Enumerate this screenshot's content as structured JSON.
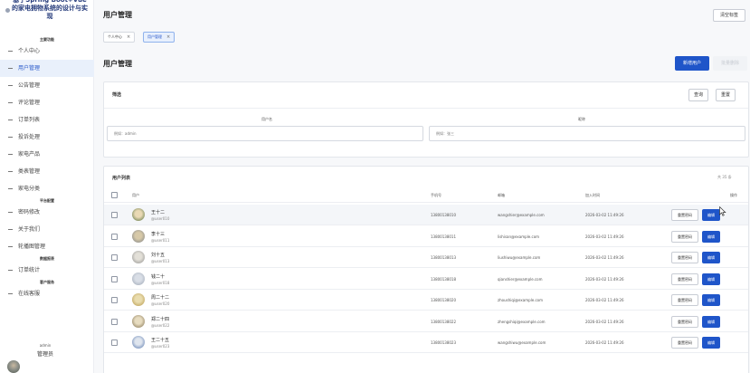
{
  "sidebar": {
    "brand_title": "基于Spring Boot+Vue的家电拥物系统的设计与实现",
    "items": [
      {
        "group": "主要功能"
      },
      {
        "label": "个人中心"
      },
      {
        "label": "用户管理",
        "active": true
      },
      {
        "label": "公告管理"
      },
      {
        "label": "评论管理"
      },
      {
        "label": "订单列表"
      },
      {
        "label": "投诉处理"
      },
      {
        "label": "家电产品"
      },
      {
        "label": "类表管理"
      },
      {
        "label": "家电分类"
      },
      {
        "group": "平台配置"
      },
      {
        "label": "密码修改"
      },
      {
        "label": "关于我们"
      },
      {
        "label": "轮播图管理"
      },
      {
        "group": "数据报表"
      },
      {
        "label": "订单统计"
      },
      {
        "group": "客户服务"
      },
      {
        "label": "在线客服"
      }
    ],
    "user": {
      "name": "admin",
      "role": "管理员"
    }
  },
  "header": {
    "title": "用户管理",
    "clear_tabs": "清空标签"
  },
  "tabs": [
    {
      "label": "个人中心",
      "close": "×"
    },
    {
      "label": "用户管理",
      "close": "×",
      "active": true
    }
  ],
  "section": {
    "title": "用户管理",
    "add_button": "新增用户",
    "faded_button": "批量删除"
  },
  "filter": {
    "title": "筛选",
    "query_button": "查询",
    "reset_button": "重置",
    "username_label": "用户名",
    "username_placeholder": "例如：admin",
    "nickname_label": "昵称",
    "nickname_placeholder": "例如：张三"
  },
  "table": {
    "title": "用户列表",
    "total": "共 35 条",
    "columns": {
      "user": "用户",
      "phone": "手机号",
      "email": "邮箱",
      "created": "加入时间",
      "actions": "操作"
    },
    "reset_pwd_label": "重置密码",
    "edit_label": "编辑",
    "rows": [
      {
        "name": "王十二",
        "username": "@user010",
        "phone": "13800138010",
        "email": "wangshier@example.com",
        "created": "2026-03-02 11:49:26"
      },
      {
        "name": "李十三",
        "username": "@user011",
        "phone": "13800138011",
        "email": "lishisan@example.com",
        "created": "2026-03-02 11:49:26"
      },
      {
        "name": "刘十五",
        "username": "@user013",
        "phone": "13800138013",
        "email": "liushiwu@example.com",
        "created": "2026-03-02 11:49:26"
      },
      {
        "name": "钱二十",
        "username": "@user018",
        "phone": "13800138018",
        "email": "qianshier@example.com",
        "created": "2026-03-02 11:49:26"
      },
      {
        "name": "周二十二",
        "username": "@user020",
        "phone": "13800138020",
        "email": "zhoushiqi@example.com",
        "created": "2026-03-02 11:49:26"
      },
      {
        "name": "郑二十四",
        "username": "@user022",
        "phone": "13800138022",
        "email": "zhengshiqi@example.com",
        "created": "2026-03-02 11:49:26"
      },
      {
        "name": "王二十五",
        "username": "@user023",
        "phone": "13800138023",
        "email": "wangshiwu@example.com",
        "created": "2026-03-02 11:49:26"
      }
    ]
  },
  "colors": {
    "accent": "#1f55c9",
    "active_bg": "#e9f0fb",
    "brand_text": "#243a7a"
  },
  "icons": {
    "checkbox": "checkbox-icon",
    "avatar": "avatar-icon",
    "cursor": "mouse-pointer-icon"
  }
}
